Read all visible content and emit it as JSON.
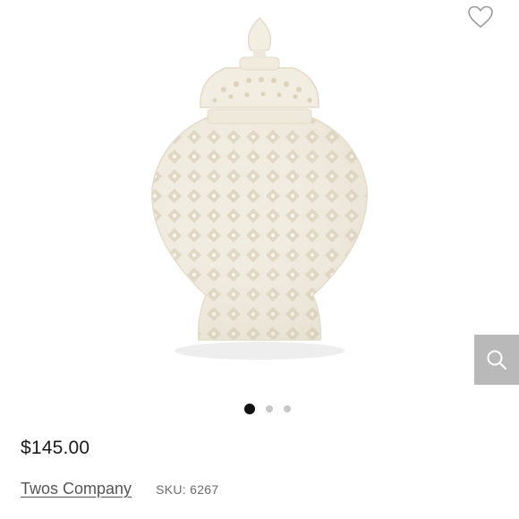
{
  "product": {
    "price": "$145.00",
    "brand": "Twos Company",
    "sku": "SKU: 6267"
  },
  "gallery": {
    "image_count": 3,
    "active_index": 0
  },
  "colors": {
    "ceramic": "#f3efe3",
    "ceramic_shade": "#e2dccb",
    "zoom_bg": "#b9b9b9",
    "dot_active": "#111111",
    "dot_inactive": "#c8c8c8"
  },
  "icons": {
    "wishlist": "heart-outline-icon",
    "zoom": "magnifier-icon"
  }
}
